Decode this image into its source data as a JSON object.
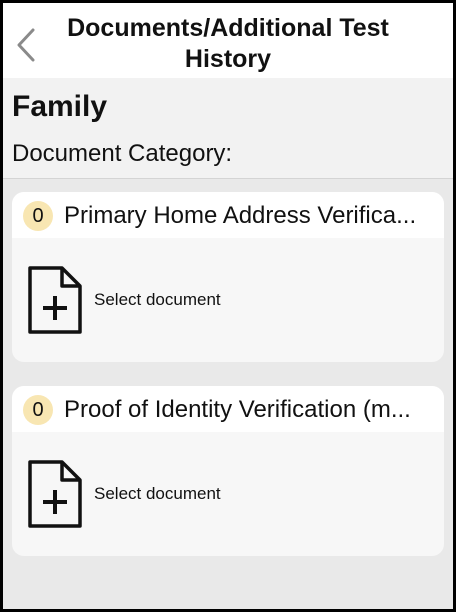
{
  "header": {
    "title": "Documents/Additional Test History",
    "back_icon": "chevron-left-icon"
  },
  "section": {
    "title": "Family",
    "subtitle": "Document Category:"
  },
  "categories": [
    {
      "count": "0",
      "title": "Primary Home Address Verifica...",
      "action_label": "Select document",
      "icon": "add-document-icon"
    },
    {
      "count": "0",
      "title": "Proof of Identity Verification (m...",
      "action_label": "Select document",
      "icon": "add-document-icon"
    }
  ],
  "colors": {
    "badge_bg": "#f8e6b2",
    "page_bg": "#e9e9e9",
    "card_bg": "#f7f7f7"
  }
}
